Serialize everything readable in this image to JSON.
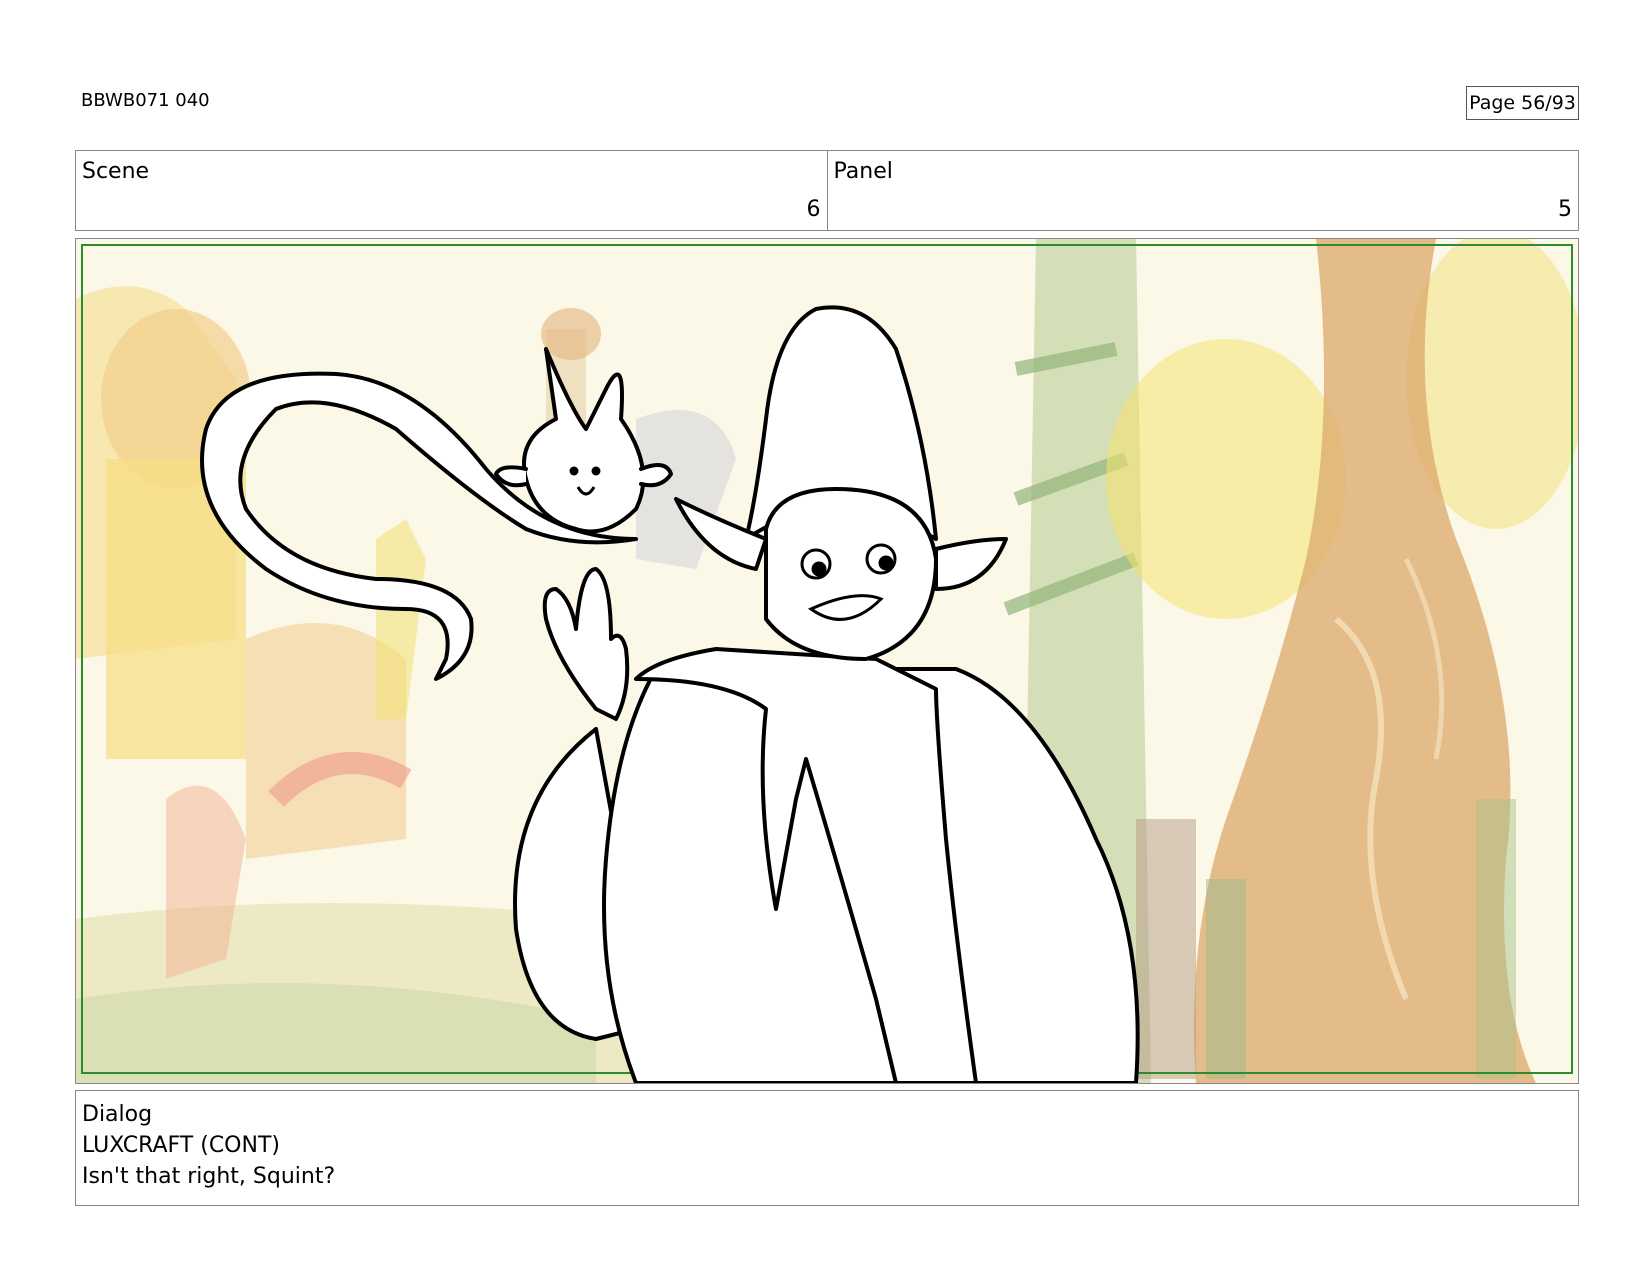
{
  "header": {
    "doc_id": "BBWB071 040",
    "page": "Page 56/93"
  },
  "scene": {
    "label": "Scene",
    "value": "6"
  },
  "panel": {
    "label": "Panel",
    "value": "5"
  },
  "dialog": {
    "label": "Dialog",
    "character": "LUXCRAFT (CONT)",
    "line": "Isn't that right, Squint?"
  },
  "colors": {
    "safe_frame": "#2e8b2e",
    "sky": "#fbf8e6",
    "tree": "#d9a86a",
    "tower": "#b8c9a0"
  }
}
